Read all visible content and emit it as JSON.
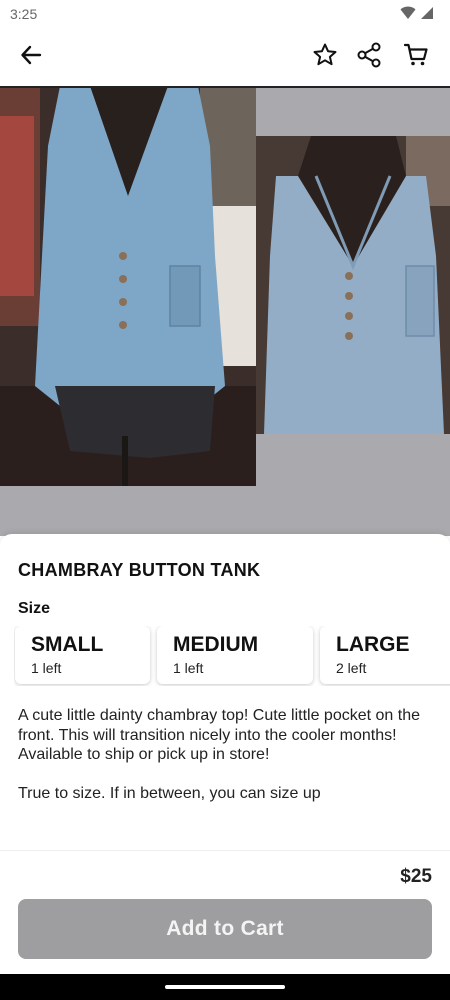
{
  "status_bar": {
    "time": "3:25",
    "icons": [
      "wifi-icon",
      "signal-icon"
    ]
  },
  "app_bar": {
    "icons": [
      "back-arrow-icon",
      "star-icon",
      "share-icon",
      "cart-icon"
    ]
  },
  "gallery": {
    "photos": [
      "photo-main",
      "photo-second"
    ]
  },
  "product": {
    "title": "CHAMBRAY BUTTON TANK",
    "size_label": "Size",
    "sizes": [
      {
        "name": "SMALL",
        "stock": "1 left"
      },
      {
        "name": "MEDIUM",
        "stock": "1 left"
      },
      {
        "name": "LARGE",
        "stock": "2 left"
      }
    ],
    "description": {
      "line1": "A cute little dainty chambray top! Cute little pocket on the front. This will transition nicely into the cooler months!",
      "line2": "Available to ship or pick up in store!",
      "line3": "True to size. If in between, you can size up"
    },
    "price": "$25",
    "add_to_cart_label": "Add to Cart"
  },
  "colors": {
    "button_bg": "#9e9d9f",
    "gallery_bg": "#aaa9ad"
  }
}
